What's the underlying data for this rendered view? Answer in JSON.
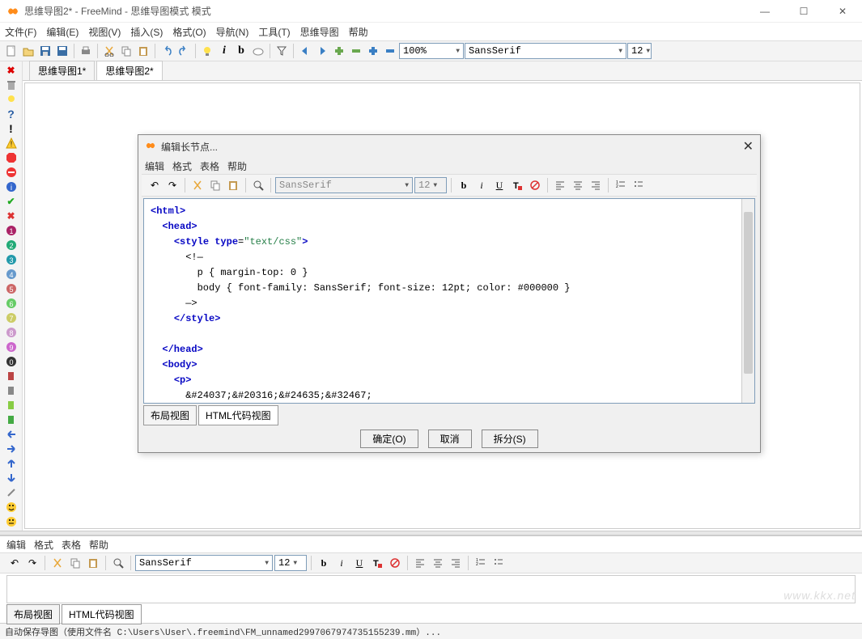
{
  "window": {
    "title": "思维导图2* - FreeMind - 思维导图模式 模式",
    "controls": {
      "min": "—",
      "max": "☐",
      "close": "✕"
    }
  },
  "menubar": [
    "文件(F)",
    "编辑(E)",
    "视图(V)",
    "插入(S)",
    "格式(O)",
    "导航(N)",
    "工具(T)",
    "思维导图",
    "帮助"
  ],
  "toolbar": {
    "zoom": "100%",
    "font": "SansSerif",
    "size": "12"
  },
  "tabs": [
    {
      "label": "思维导图1*",
      "active": false
    },
    {
      "label": "思维导图2*",
      "active": true
    }
  ],
  "dialog": {
    "title": "编辑长节点...",
    "menubar": [
      "编辑",
      "格式",
      "表格",
      "帮助"
    ],
    "font": "SansSerif",
    "size": "12",
    "editor_lines": [
      {
        "indent": 0,
        "open": "<html>"
      },
      {
        "indent": 1,
        "open": "<head>"
      },
      {
        "indent": 2,
        "open_attr": {
          "tag": "style",
          "attr": "type",
          "val": "\"text/css\""
        }
      },
      {
        "indent": 3,
        "text": "<!—"
      },
      {
        "indent": 4,
        "text": "p { margin-top: 0 }"
      },
      {
        "indent": 4,
        "text": "body { font-family: SansSerif; font-size: 12pt; color: #000000 }"
      },
      {
        "indent": 3,
        "text": "—>"
      },
      {
        "indent": 2,
        "close": "</style>"
      },
      {
        "indent": 1,
        "blank": true
      },
      {
        "indent": 1,
        "close": "</head>"
      },
      {
        "indent": 1,
        "open": "<body>"
      },
      {
        "indent": 2,
        "open": "<p>"
      },
      {
        "indent": 3,
        "text": "&#24037;&#20316;&#24635;&#32467;"
      }
    ],
    "view_tabs": [
      {
        "label": "布局视图",
        "active": false
      },
      {
        "label": "HTML代码视图",
        "active": true
      }
    ],
    "buttons": {
      "ok": "确定(O)",
      "cancel": "取消",
      "split": "拆分(S)"
    }
  },
  "bottom_panel": {
    "menubar": [
      "编辑",
      "格式",
      "表格",
      "帮助"
    ],
    "font": "SansSerif",
    "size": "12",
    "view_tabs": [
      {
        "label": "布局视图",
        "active": false
      },
      {
        "label": "HTML代码视图",
        "active": true
      }
    ]
  },
  "statusbar": "自动保存导图（使用文件名 C:\\Users\\User\\.freemind\\FM_unnamed2997067974735155239.mm）...",
  "watermark": "www.kkx.net"
}
